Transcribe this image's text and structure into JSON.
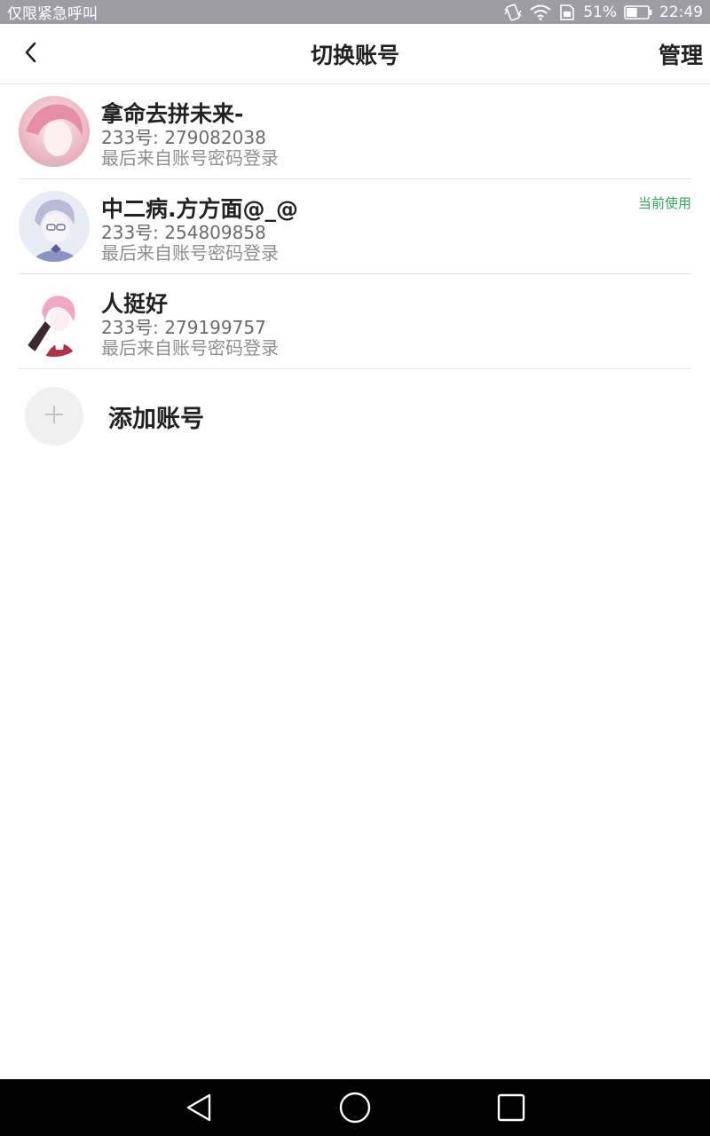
{
  "status_bar": {
    "carrier": "仅限紧急呼叫",
    "battery_percent": "51%",
    "time": "22:49",
    "battery_level": 0.51
  },
  "header": {
    "back_icon": "chevron-left-icon",
    "title": "切换账号",
    "manage_label": "管理"
  },
  "accounts": [
    {
      "name": "拿命去拼未来-",
      "id": "233号: 279082038",
      "login_info": "最后来自账号密码登录",
      "current": false,
      "avatar_colors": [
        "#f7d6dc",
        "#e8a9b8"
      ]
    },
    {
      "name": "中二病.方方面@_@",
      "id": "233号: 254809858",
      "login_info": "最后来自账号密码登录",
      "current": true,
      "current_label": "当前使用",
      "avatar_colors": [
        "#e6e8f4",
        "#8d92c4"
      ]
    },
    {
      "name": "人挺好",
      "id": "233号: 279199757",
      "login_info": "最后来自账号密码登录",
      "current": false,
      "avatar_colors": [
        "#f2cfe0",
        "#b03248"
      ]
    }
  ],
  "add_account": {
    "icon": "plus-icon",
    "label": "添加账号"
  },
  "system_nav": {
    "back_icon": "triangle-back-icon",
    "home_icon": "circle-home-icon",
    "recents_icon": "square-recents-icon"
  },
  "colors": {
    "status_bar_bg": "#9e9ca4",
    "accent_green": "#3aa35b",
    "system_nav_bg": "#000000"
  }
}
